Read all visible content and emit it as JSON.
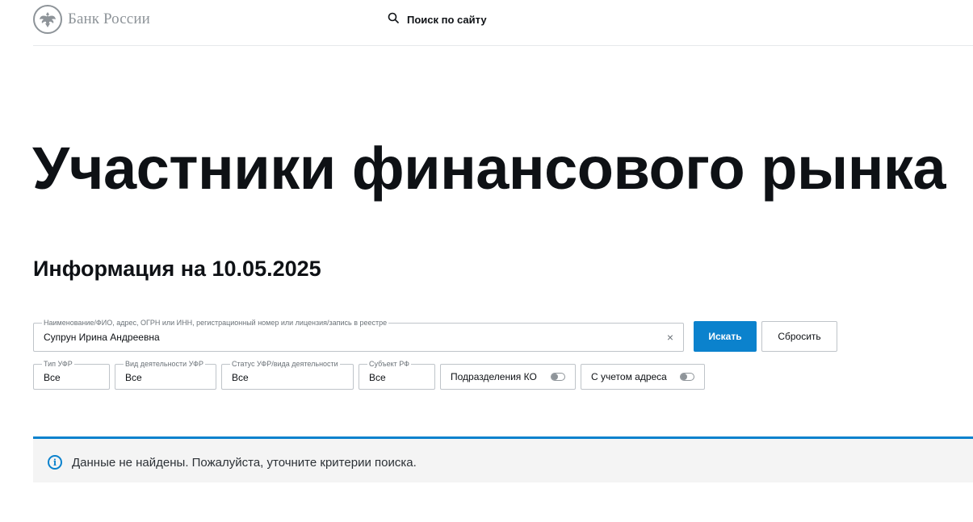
{
  "header": {
    "logo_text": "Банк России",
    "search_label": "Поиск по сайту"
  },
  "page_title": "Участники финансового рынка",
  "info_date": "Информация на 10.05.2025",
  "search": {
    "label": "Наименование/ФИО, адрес, ОГРН или ИНН, регистрационный номер или лицензия/запись в реестре",
    "value": "Супрун Ирина Андреевна",
    "clear_symbol": "×",
    "search_button": "Искать",
    "reset_button": "Сбросить"
  },
  "filters": [
    {
      "label": "Тип УФР",
      "value": "Все"
    },
    {
      "label": "Вид деятельности УФР",
      "value": "Все"
    },
    {
      "label": "Статус УФР/вида деятельности",
      "value": "Все"
    },
    {
      "label": "Субъект РФ",
      "value": "Все"
    }
  ],
  "toggles": [
    {
      "label": "Подразделения КО",
      "on": false
    },
    {
      "label": "С учетом адреса",
      "on": false
    }
  ],
  "notice": {
    "icon": "info-icon",
    "text": "Данные не найдены. Пожалуйста, уточните критерии поиска."
  },
  "colors": {
    "accent": "#0b82cd",
    "notice_bg": "#f4f4f4",
    "logo_grey": "#8e9499"
  }
}
